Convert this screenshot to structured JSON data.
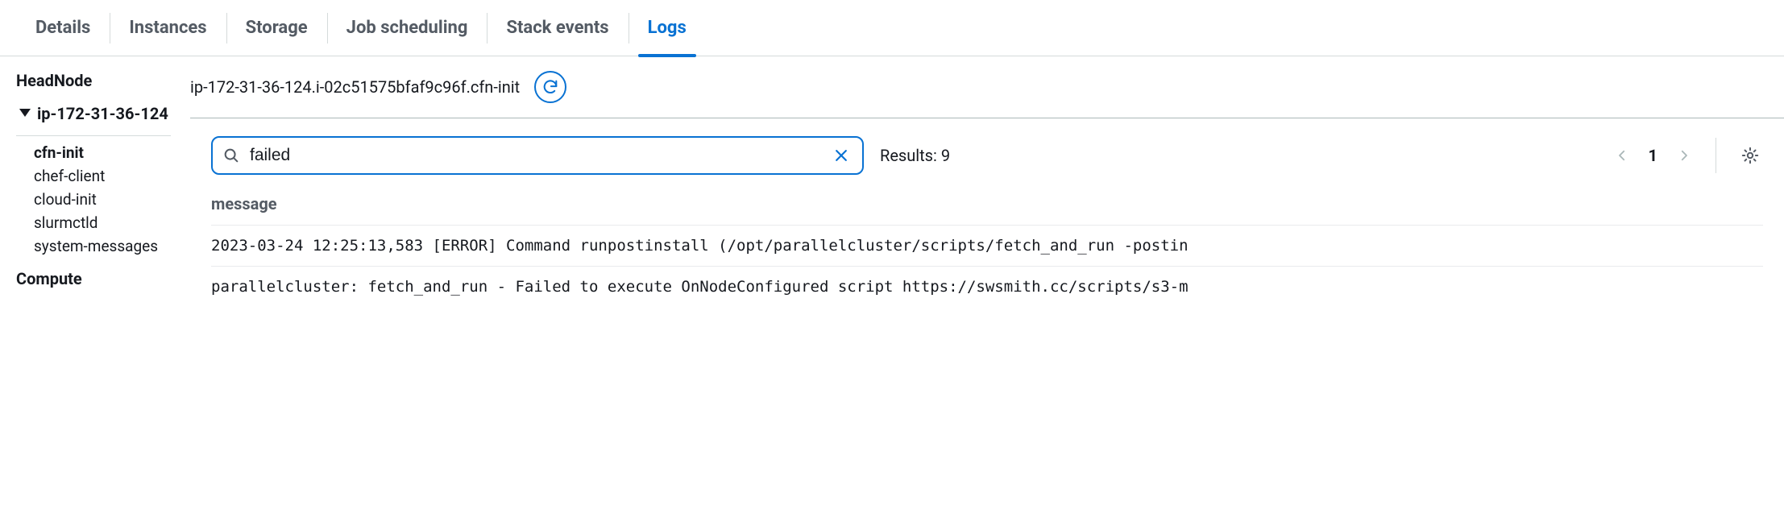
{
  "tabs": [
    {
      "label": "Details",
      "active": false
    },
    {
      "label": "Instances",
      "active": false
    },
    {
      "label": "Storage",
      "active": false
    },
    {
      "label": "Job scheduling",
      "active": false
    },
    {
      "label": "Stack events",
      "active": false
    },
    {
      "label": "Logs",
      "active": true
    }
  ],
  "sidebar": {
    "headnode_label": "HeadNode",
    "node_name": "ip-172-31-36-124",
    "logs": [
      "cfn-init",
      "chef-client",
      "cloud-init",
      "slurmctld",
      "system-messages"
    ],
    "selected_log": "cfn-init",
    "compute_label": "Compute"
  },
  "content": {
    "stream_name": "ip-172-31-36-124.i-02c51575bfaf9c96f.cfn-init",
    "search_value": "failed",
    "results_label": "Results:",
    "results_count": "9",
    "page": "1",
    "column_header": "message",
    "rows": [
      "2023-03-24 12:25:13,583 [ERROR] Command runpostinstall (/opt/parallelcluster/scripts/fetch_and_run -postin",
      "parallelcluster: fetch_and_run - Failed to execute OnNodeConfigured script https://swsmith.cc/scripts/s3-m"
    ]
  }
}
